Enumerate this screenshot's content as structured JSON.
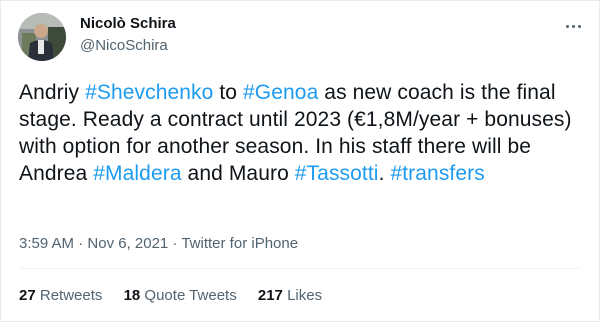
{
  "author": {
    "display_name": "Nicolò Schira",
    "handle": "@NicoSchira",
    "avatar_icon": "profile-photo"
  },
  "menu": {
    "icon": "more-options-icon"
  },
  "tweet": {
    "segments": [
      {
        "text": "Andriy ",
        "type": "text"
      },
      {
        "text": "#Shevchenko",
        "type": "hashtag"
      },
      {
        "text": " to ",
        "type": "text"
      },
      {
        "text": "#Genoa",
        "type": "hashtag"
      },
      {
        "text": " as new coach is the final stage. Ready a contract until 2023 (€1,8M/year + bonuses) with option for another season. In his staff there will be Andrea ",
        "type": "text"
      },
      {
        "text": "#Maldera",
        "type": "hashtag"
      },
      {
        "text": " and Mauro ",
        "type": "text"
      },
      {
        "text": "#Tassotti",
        "type": "hashtag"
      },
      {
        "text": ". ",
        "type": "text"
      },
      {
        "text": "#transfers",
        "type": "hashtag"
      }
    ]
  },
  "meta": {
    "time": "3:59 AM",
    "separator": " · ",
    "date": "Nov 6, 2021",
    "source": "Twitter for iPhone"
  },
  "stats": {
    "retweets_count": "27",
    "retweets_label": "Retweets",
    "quotes_count": "18",
    "quotes_label": "Quote Tweets",
    "likes_count": "217",
    "likes_label": "Likes"
  },
  "colors": {
    "hashtag": "#1d9bf0",
    "secondary_text": "#536471",
    "primary_text": "#0f1419"
  }
}
